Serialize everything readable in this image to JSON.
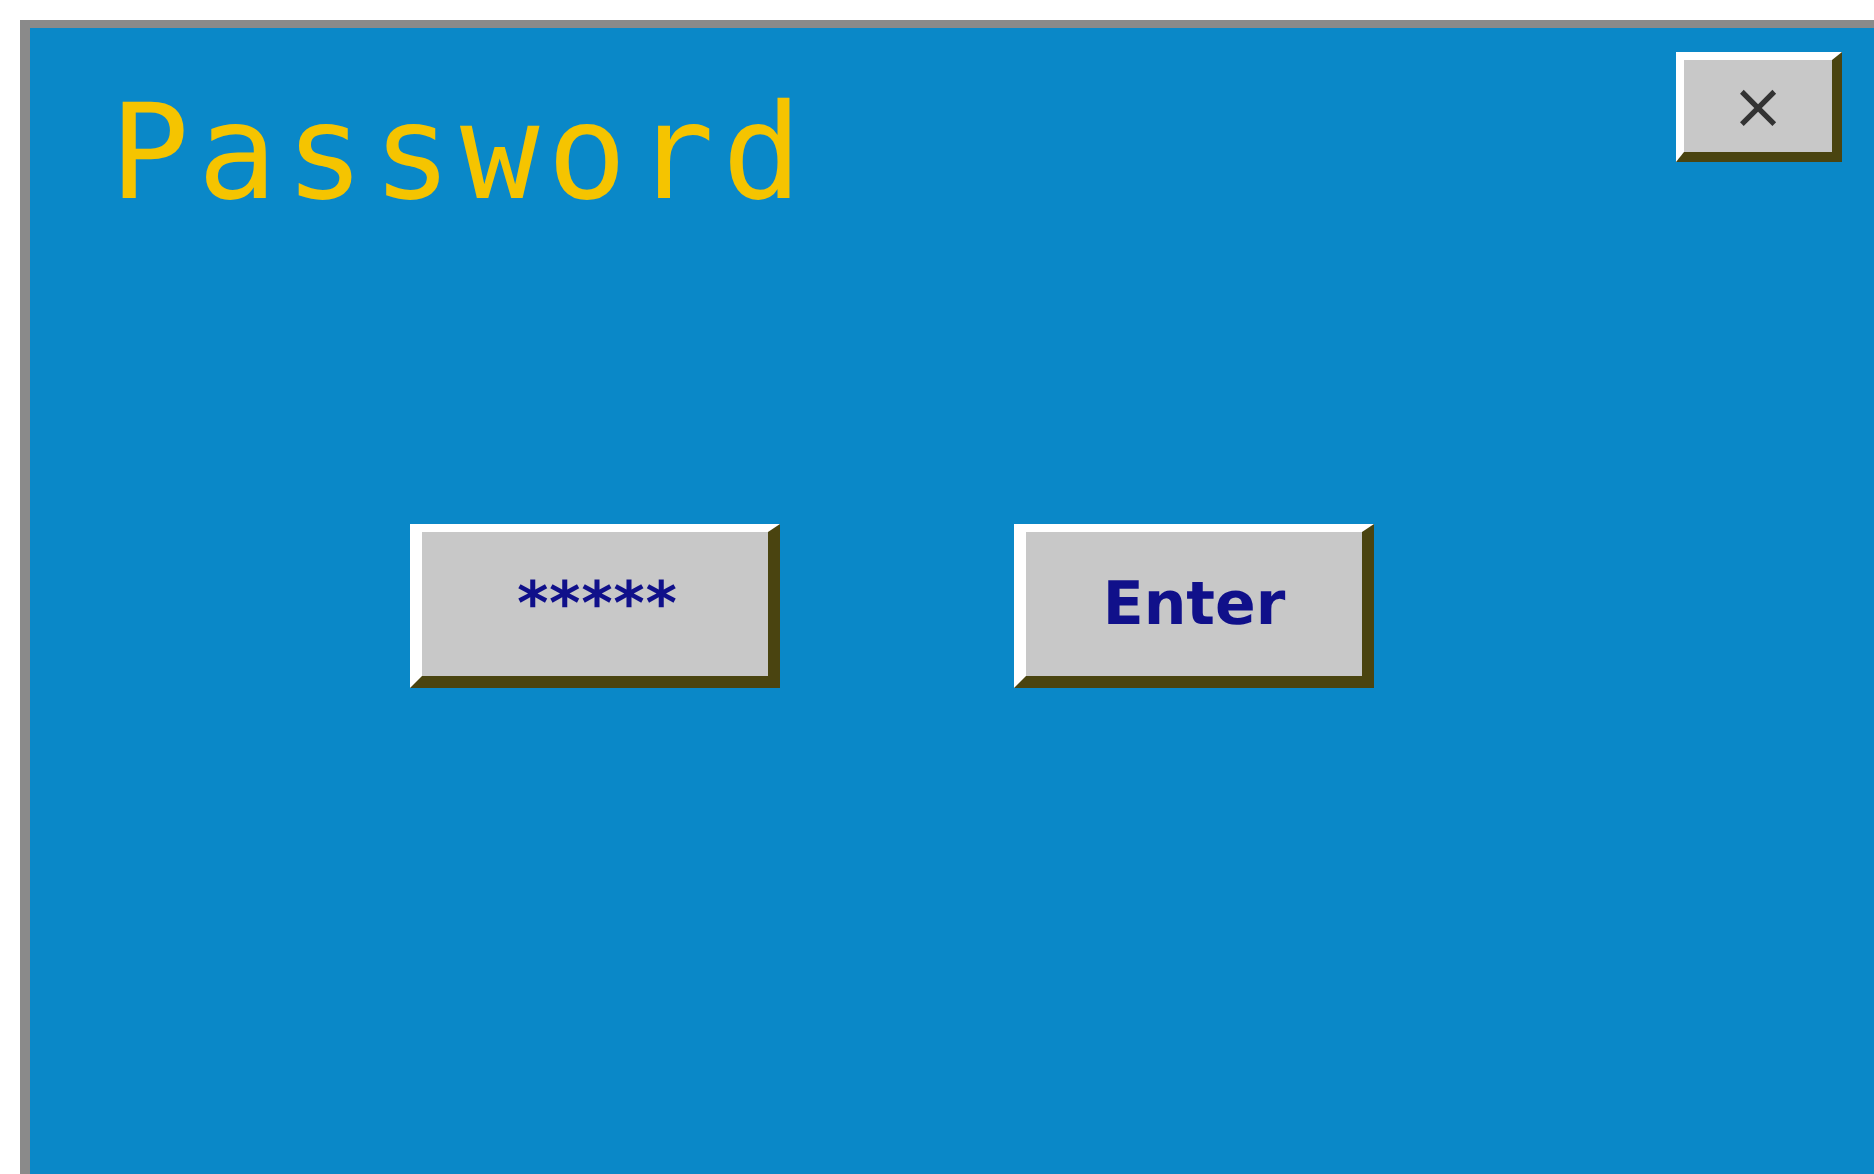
{
  "dialog": {
    "title": "Password",
    "close": "×"
  },
  "password_field": {
    "value": "*****"
  },
  "buttons": [
    "Enter"
  ]
}
